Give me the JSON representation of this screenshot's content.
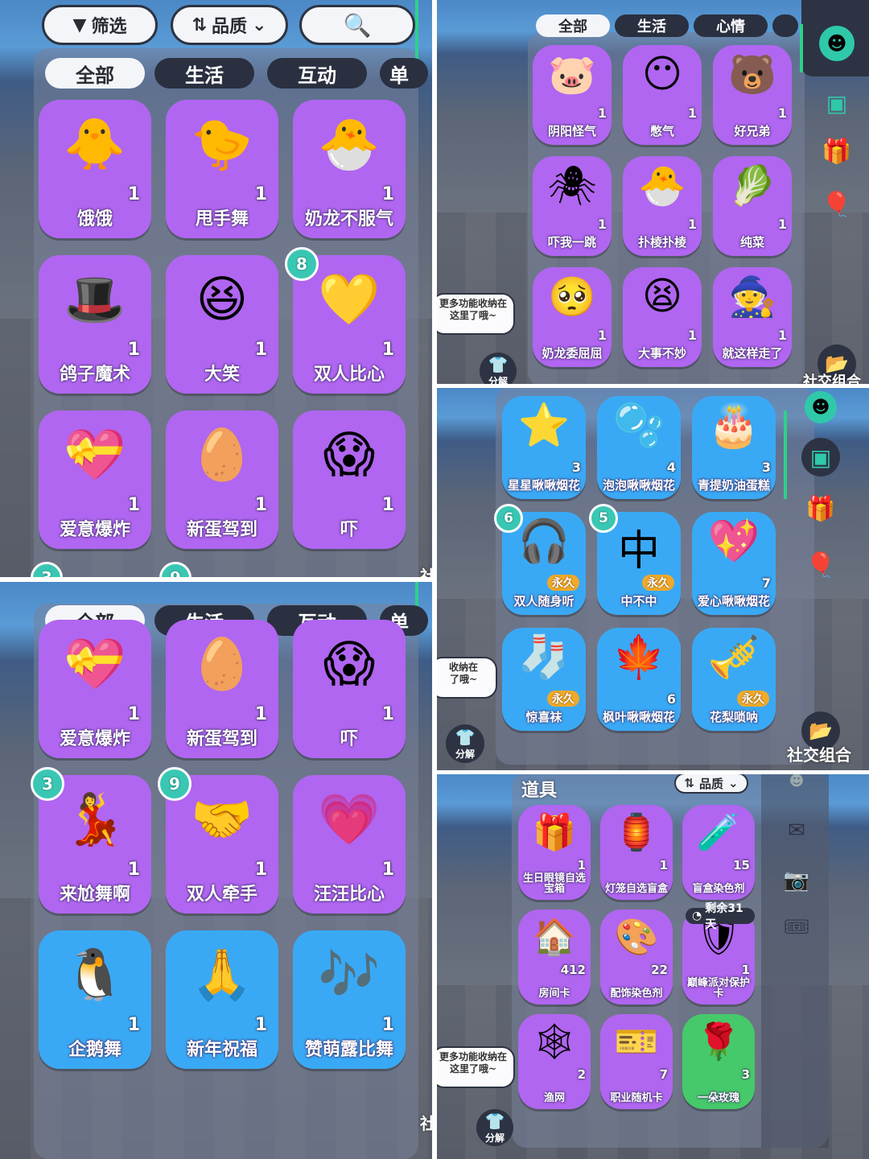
{
  "toolbar": {
    "filter": "筛选",
    "quality": "品质"
  },
  "tabs_a": [
    "全部",
    "生活",
    "互动",
    "单"
  ],
  "tabs_b": [
    "全部",
    "生活",
    "心情"
  ],
  "panel_tl": {
    "items": [
      {
        "label": "饿饿",
        "count": "1"
      },
      {
        "label": "甩手舞",
        "count": "1"
      },
      {
        "label": "奶龙不服气",
        "count": "1"
      },
      {
        "label": "鸽子魔术",
        "count": "1"
      },
      {
        "label": "大笑",
        "count": "1"
      },
      {
        "label": "双人比心",
        "count": "1",
        "badge": "8"
      },
      {
        "label": "爱意爆炸",
        "count": "1"
      },
      {
        "label": "新蛋驾到",
        "count": "1"
      },
      {
        "label": "吓",
        "count": "1"
      }
    ],
    "peek_badges": [
      "3",
      "9"
    ],
    "side_text": "社"
  },
  "panel_bl": {
    "items": [
      {
        "label": "爱意爆炸",
        "count": "1"
      },
      {
        "label": "新蛋驾到",
        "count": "1"
      },
      {
        "label": "吓",
        "count": "1"
      },
      {
        "label": "来尬舞啊",
        "count": "1",
        "badge": "3"
      },
      {
        "label": "双人牵手",
        "count": "1",
        "badge": "9"
      },
      {
        "label": "汪汪比心",
        "count": "1"
      },
      {
        "label": "企鹅舞",
        "count": "1"
      },
      {
        "label": "新年祝福",
        "count": "1"
      },
      {
        "label": "赞萌露比舞",
        "count": "1"
      }
    ],
    "side_text": "社"
  },
  "panel_tr": {
    "items": [
      {
        "label": "阴阳怪气",
        "count": "1"
      },
      {
        "label": "憋气",
        "count": "1"
      },
      {
        "label": "好兄弟",
        "count": "1"
      },
      {
        "label": "吓我一跳",
        "count": "1"
      },
      {
        "label": "扑棱扑棱",
        "count": "1"
      },
      {
        "label": "纯菜",
        "count": "1"
      },
      {
        "label": "奶龙委屈屈",
        "count": "1"
      },
      {
        "label": "大事不妙",
        "count": "1"
      },
      {
        "label": "就这样走了",
        "count": "1"
      }
    ],
    "bubble": "更多功能收纳在\n这里了哦~",
    "social": "社交组合",
    "decompose": "分解"
  },
  "panel_mr": {
    "items": [
      {
        "label": "星星啾啾烟花",
        "count": "3"
      },
      {
        "label": "泡泡啾啾烟花",
        "count": "4"
      },
      {
        "label": "青提奶油蛋糕",
        "count": "3"
      },
      {
        "label": "双人随身听",
        "perm": "永久",
        "badge": "6"
      },
      {
        "label": "中不中",
        "perm": "永久",
        "badge": "5"
      },
      {
        "label": "爱心啾啾烟花",
        "count": "7"
      },
      {
        "label": "惊喜袜",
        "perm": "永久"
      },
      {
        "label": "枫叶啾啾烟花",
        "count": "6"
      },
      {
        "label": "花梨唢呐",
        "perm": "永久"
      }
    ],
    "bubble": "收纳在\n了哦~",
    "decompose": "分解",
    "social": "社交组合",
    "glyph": "中"
  },
  "panel_br": {
    "title": "道具",
    "quality": "品质",
    "items": [
      {
        "label": "生日眼镜自选宝箱",
        "count": "1"
      },
      {
        "label": "灯笼自选盲盒",
        "count": "1"
      },
      {
        "label": "盲盒染色剂",
        "count": "15"
      },
      {
        "label": "房间卡",
        "count": "412"
      },
      {
        "label": "配饰染色剂",
        "count": "22"
      },
      {
        "label": "巅峰派对保护卡",
        "count": "1",
        "timer": "剩余31天"
      },
      {
        "label": "渔网",
        "count": "2"
      },
      {
        "label": "职业随机卡",
        "count": "7"
      },
      {
        "label": "一朵玫瑰",
        "count": "3"
      }
    ],
    "bubble": "更多功能收纳在\n这里了哦~",
    "decompose": "分解"
  },
  "colors": {
    "purple": "#b066f0",
    "blue": "#3aa9f5",
    "green": "#46c96a",
    "badge": "#39c7b4",
    "gold": "#f0a92a"
  }
}
